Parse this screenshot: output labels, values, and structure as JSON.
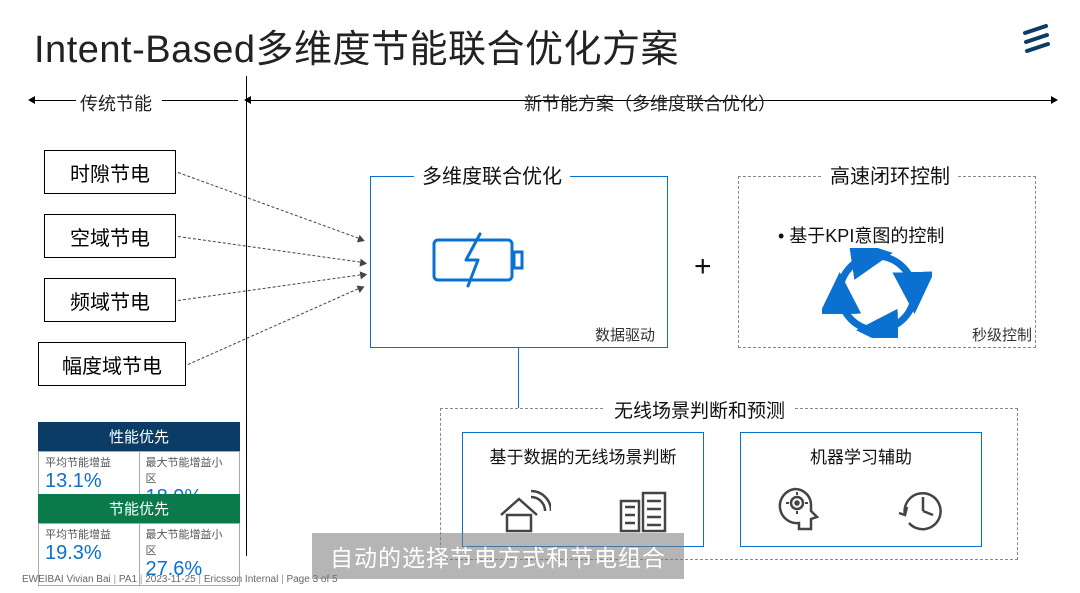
{
  "title": "Intent-Based多维度节能联合优化方案",
  "section": {
    "left": "传统节能",
    "right": "新节能方案（多维度联合优化）"
  },
  "left_items": [
    "时隙节电",
    "空域节电",
    "频域节电",
    "幅度域节电"
  ],
  "mid_box": {
    "title": "多维度联合优化",
    "footer": "数据驱动"
  },
  "plus": "+",
  "right_box": {
    "title": "高速闭环控制",
    "bullet": "• 基于KPI意图的控制",
    "footer": "秒级控制"
  },
  "bottom_group": {
    "title": "无线场景判断和预测",
    "left": "基于数据的无线场景判断",
    "right": "机器学习辅助"
  },
  "metrics": [
    {
      "header": "性能优先",
      "cells": [
        {
          "k": "平均节能增益",
          "v": "13.1%"
        },
        {
          "k": "最大节能增益小区",
          "v": "18.9%"
        }
      ]
    },
    {
      "header": "节能优先",
      "cells": [
        {
          "k": "平均节能增益",
          "v": "19.3%"
        },
        {
          "k": "最大节能增益小区",
          "v": "27.6%"
        }
      ]
    }
  ],
  "footer": [
    "EWEIBAI Vivian Bai",
    "PA1",
    "2023-11-25",
    "Ericsson Internal",
    "Page 3 of 5"
  ],
  "caption": "自动的选择节电方式和节电组合"
}
